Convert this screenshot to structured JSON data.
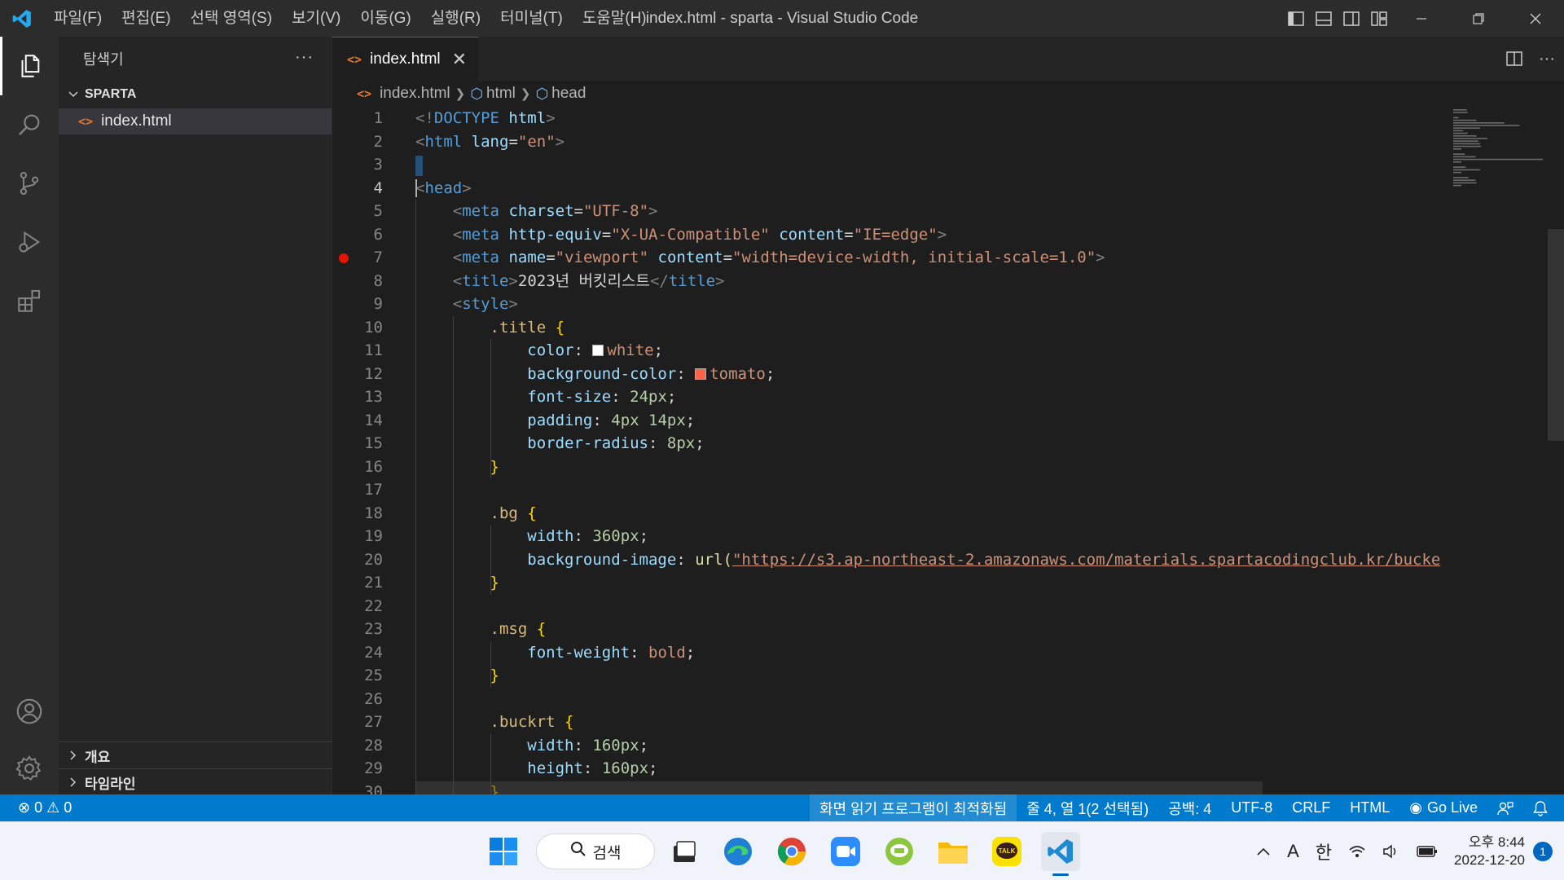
{
  "titlebar": {
    "menus": [
      "파일(F)",
      "편집(E)",
      "선택 영역(S)",
      "보기(V)",
      "이동(G)",
      "실행(R)",
      "터미널(T)",
      "도움말(H)"
    ],
    "window_title": "index.html - sparta - Visual Studio Code"
  },
  "activitybar": {
    "icons": [
      "explorer-icon",
      "search-icon",
      "source-control-icon",
      "run-debug-icon",
      "extensions-icon",
      "accounts-icon",
      "manage-gear-icon"
    ]
  },
  "sidebar": {
    "title": "탐색기",
    "more": "···",
    "folder": "SPARTA",
    "file": "index.html",
    "outline": "개요",
    "timeline": "타임라인"
  },
  "editor": {
    "tab_label": "index.html",
    "tab_close": "✕",
    "breadcrumb": [
      "index.html",
      "html",
      "head"
    ],
    "current_line": 4,
    "breakpoint_line": 7,
    "swatch_colors": {
      "white": "#ffffff",
      "tomato": "#ff6347"
    },
    "lines": [
      [
        [
          "pun",
          "<!"
        ],
        [
          "tag",
          "DOCTYPE"
        ],
        [
          "txt",
          " "
        ],
        [
          "attr",
          "html"
        ],
        [
          "pun",
          ">"
        ]
      ],
      [
        [
          "pun",
          "<"
        ],
        [
          "tag",
          "html"
        ],
        [
          "txt",
          " "
        ],
        [
          "attr",
          "lang"
        ],
        [
          "txt",
          "="
        ],
        [
          "str",
          "\"en\""
        ],
        [
          "pun",
          ">"
        ]
      ],
      [],
      [
        [
          "pun",
          "<"
        ],
        [
          "tag",
          "head"
        ],
        [
          "pun",
          ">"
        ]
      ],
      [
        [
          "txt",
          "    "
        ],
        [
          "pun",
          "<"
        ],
        [
          "tag",
          "meta"
        ],
        [
          "txt",
          " "
        ],
        [
          "attr",
          "charset"
        ],
        [
          "txt",
          "="
        ],
        [
          "str",
          "\"UTF-8\""
        ],
        [
          "pun",
          ">"
        ]
      ],
      [
        [
          "txt",
          "    "
        ],
        [
          "pun",
          "<"
        ],
        [
          "tag",
          "meta"
        ],
        [
          "txt",
          " "
        ],
        [
          "attr",
          "http-equiv"
        ],
        [
          "txt",
          "="
        ],
        [
          "str",
          "\"X-UA-Compatible\""
        ],
        [
          "txt",
          " "
        ],
        [
          "attr",
          "content"
        ],
        [
          "txt",
          "="
        ],
        [
          "str",
          "\"IE=edge\""
        ],
        [
          "pun",
          ">"
        ]
      ],
      [
        [
          "txt",
          "    "
        ],
        [
          "pun",
          "<"
        ],
        [
          "tag",
          "meta"
        ],
        [
          "txt",
          " "
        ],
        [
          "attr",
          "name"
        ],
        [
          "txt",
          "="
        ],
        [
          "str",
          "\"viewport\""
        ],
        [
          "txt",
          " "
        ],
        [
          "attr",
          "content"
        ],
        [
          "txt",
          "="
        ],
        [
          "str",
          "\"width=device-width, initial-scale=1.0\""
        ],
        [
          "pun",
          ">"
        ]
      ],
      [
        [
          "txt",
          "    "
        ],
        [
          "pun",
          "<"
        ],
        [
          "tag",
          "title"
        ],
        [
          "pun",
          ">"
        ],
        [
          "txt",
          "2023년 버킷리스트"
        ],
        [
          "pun",
          "</"
        ],
        [
          "tag",
          "title"
        ],
        [
          "pun",
          ">"
        ]
      ],
      [
        [
          "txt",
          "    "
        ],
        [
          "pun",
          "<"
        ],
        [
          "tag",
          "style"
        ],
        [
          "pun",
          ">"
        ]
      ],
      [
        [
          "txt",
          "        "
        ],
        [
          "sel",
          ".title"
        ],
        [
          "txt",
          " "
        ],
        [
          "brace",
          "{"
        ]
      ],
      [
        [
          "txt",
          "            "
        ],
        [
          "prop",
          "color"
        ],
        [
          "txt",
          ": "
        ],
        [
          "swatch",
          "white"
        ],
        [
          "val",
          "white"
        ],
        [
          "txt",
          ";"
        ]
      ],
      [
        [
          "txt",
          "            "
        ],
        [
          "prop",
          "background-color"
        ],
        [
          "txt",
          ": "
        ],
        [
          "swatch",
          "tomato"
        ],
        [
          "val",
          "tomato"
        ],
        [
          "txt",
          ";"
        ]
      ],
      [
        [
          "txt",
          "            "
        ],
        [
          "prop",
          "font-size"
        ],
        [
          "txt",
          ": "
        ],
        [
          "num",
          "24px"
        ],
        [
          "txt",
          ";"
        ]
      ],
      [
        [
          "txt",
          "            "
        ],
        [
          "prop",
          "padding"
        ],
        [
          "txt",
          ": "
        ],
        [
          "num",
          "4px"
        ],
        [
          "txt",
          " "
        ],
        [
          "num",
          "14px"
        ],
        [
          "txt",
          ";"
        ]
      ],
      [
        [
          "txt",
          "            "
        ],
        [
          "prop",
          "border-radius"
        ],
        [
          "txt",
          ": "
        ],
        [
          "num",
          "8px"
        ],
        [
          "txt",
          ";"
        ]
      ],
      [
        [
          "txt",
          "        "
        ],
        [
          "brace",
          "}"
        ]
      ],
      [],
      [
        [
          "txt",
          "        "
        ],
        [
          "sel",
          ".bg"
        ],
        [
          "txt",
          " "
        ],
        [
          "brace",
          "{"
        ]
      ],
      [
        [
          "txt",
          "            "
        ],
        [
          "prop",
          "width"
        ],
        [
          "txt",
          ": "
        ],
        [
          "num",
          "360px"
        ],
        [
          "txt",
          ";"
        ]
      ],
      [
        [
          "txt",
          "            "
        ],
        [
          "prop",
          "background-image"
        ],
        [
          "txt",
          ": "
        ],
        [
          "fn",
          "url("
        ],
        [
          "url",
          "\"https://s3.ap-northeast-2.amazonaws.com/materials.spartacodingclub.kr/bucke"
        ]
      ],
      [
        [
          "txt",
          "        "
        ],
        [
          "brace",
          "}"
        ]
      ],
      [],
      [
        [
          "txt",
          "        "
        ],
        [
          "sel",
          ".msg"
        ],
        [
          "txt",
          " "
        ],
        [
          "brace",
          "{"
        ]
      ],
      [
        [
          "txt",
          "            "
        ],
        [
          "prop",
          "font-weight"
        ],
        [
          "txt",
          ": "
        ],
        [
          "val",
          "bold"
        ],
        [
          "txt",
          ";"
        ]
      ],
      [
        [
          "txt",
          "        "
        ],
        [
          "brace",
          "}"
        ]
      ],
      [],
      [
        [
          "txt",
          "        "
        ],
        [
          "sel",
          ".buckrt"
        ],
        [
          "txt",
          " "
        ],
        [
          "brace",
          "{"
        ]
      ],
      [
        [
          "txt",
          "            "
        ],
        [
          "prop",
          "width"
        ],
        [
          "txt",
          ": "
        ],
        [
          "num",
          "160px"
        ],
        [
          "txt",
          ";"
        ]
      ],
      [
        [
          "txt",
          "            "
        ],
        [
          "prop",
          "height"
        ],
        [
          "txt",
          ": "
        ],
        [
          "num",
          "160px"
        ],
        [
          "txt",
          ";"
        ]
      ],
      [
        [
          "txt",
          "        "
        ],
        [
          "brace",
          "}"
        ]
      ]
    ]
  },
  "statusbar": {
    "problems": "⊗ 0 ⚠ 0",
    "screen_reader": "화면 읽기 프로그램이 최적화됨",
    "position": "줄 4, 열 1(2 선택됨)",
    "indent": "공백: 4",
    "encoding": "UTF-8",
    "eol": "CRLF",
    "language": "HTML",
    "golive": "Go Live"
  },
  "taskbar": {
    "search_label": "검색",
    "ime_mode": "A",
    "ime_lang": "한",
    "time": "오후 8:44",
    "date": "2022-12-20",
    "notification_count": "1",
    "kakao_label": "TALK"
  }
}
